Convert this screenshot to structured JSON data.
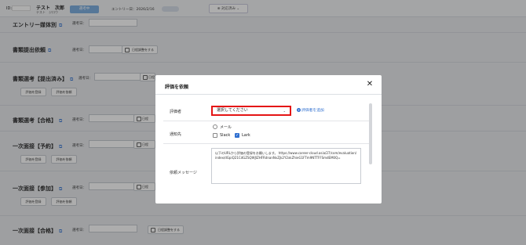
{
  "header": {
    "id_label": "ID:",
    "name": "テスト　次郎",
    "name_kana": "テスト　ジロウ",
    "stage": "選考中",
    "entry_date": "エントリー日：2026/2/16",
    "status_label": "対応済み"
  },
  "sections": [
    {
      "title": "エントリー媒体別",
      "select_label": "選考日："
    },
    {
      "title": "書類提出依頼",
      "select_label": "選考日：",
      "adjust_label": "日程調整をする"
    },
    {
      "title": "書類選考【提出済み】",
      "select_label": "選考日：",
      "adjust_label": "日程",
      "register_label": "評価を登録",
      "request_label": "評価を依頼"
    },
    {
      "title": "書類選考【合格】",
      "select_label": "選考日：",
      "adjust_label": "日程"
    },
    {
      "title": "一次面接【予約】",
      "select_label": "選考日：",
      "adjust_label": "日程",
      "register_label": "評価を登録",
      "request_label": "評価を依頼"
    },
    {
      "title": "一次面接【参加】",
      "select_label": "選考日：",
      "adjust_label": "日程",
      "register_label": "評価を登録",
      "request_label": "評価を依頼"
    },
    {
      "title": "一次面接【合格】",
      "select_label": "選考日：",
      "adjust_label": "日程調整をする"
    }
  ],
  "modal": {
    "title": "評価を依頼",
    "evaluator_label": "評価者",
    "evaluator_select": "選択してください",
    "add_evaluator": "評価者を追加",
    "notify_label": "通知先",
    "notify_options": {
      "mail": "メール",
      "slack": "Slack",
      "lark": "Lark"
    },
    "message_label": "依頼メッセージ",
    "message_text": "以下のURLから評価の登録をお願いします。 https://www.career-cloud.asia/27/com/evaluation/index/dGpiQ21CdGZSQWJIZHFRdnanNvZjk2Y2xkZhieG1FTm9NTTFFSmdEM0Q="
  },
  "colors": {
    "highlight": "#e41515",
    "accent": "#2f6fd0"
  },
  "icons": {
    "close": "close-icon",
    "external": "external-link-icon",
    "calendar": "calendar-icon",
    "chevron": "chevron-down-icon"
  }
}
